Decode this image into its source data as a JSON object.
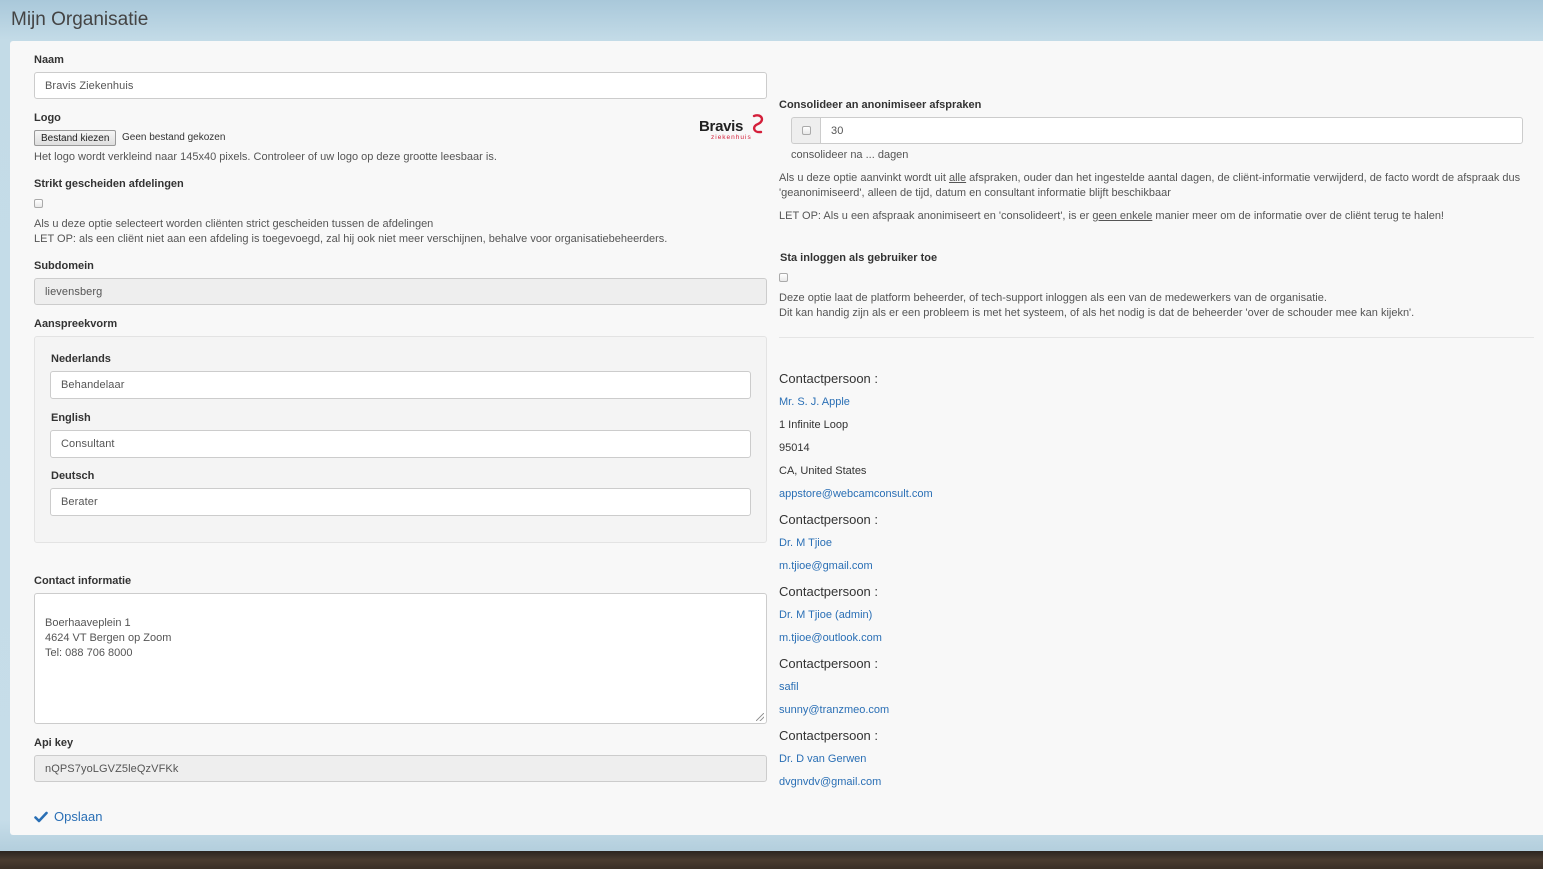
{
  "page": {
    "title": "Mijn Organisatie"
  },
  "left": {
    "naam": {
      "label": "Naam",
      "value": "Bravis Ziekenhuis"
    },
    "logo": {
      "label": "Logo",
      "file_button": "Bestand kiezen",
      "file_status": "Geen bestand gekozen",
      "help": "Het logo wordt verkleind naar 145x40 pixels. Controleer of uw logo op deze grootte leesbaar is.",
      "logo_text": "Bravis",
      "logo_subtext": "ziekenhuis",
      "logo_color": "#d41f3a"
    },
    "strikt": {
      "label": "Strikt gescheiden afdelingen",
      "help1": "Als u deze optie selecteert worden cliënten strict gescheiden tussen de afdelingen",
      "help2": "LET OP: als een cliënt niet aan een afdeling is toegevoegd, zal hij ook niet meer verschijnen, behalve voor organisatiebeheerders."
    },
    "subdomein": {
      "label": "Subdomein",
      "value": "lievensberg"
    },
    "aanspreekvorm": {
      "label": "Aanspreekvorm",
      "nederlands": {
        "label": "Nederlands",
        "value": "Behandelaar"
      },
      "english": {
        "label": "English",
        "value": "Consultant"
      },
      "deutsch": {
        "label": "Deutsch",
        "value": "Berater"
      }
    },
    "contact": {
      "label": "Contact informatie",
      "value": "Boerhaaveplein 1\n4624 VT Bergen op Zoom\nTel: 088 706 8000"
    },
    "apikey": {
      "label": "Api key",
      "value": "nQPS7yoLGVZ5leQzVFKk"
    },
    "save_label": "Opslaan"
  },
  "right": {
    "consolideer": {
      "label": "Consolideer an anonimiseer afspraken",
      "days_value": "30",
      "days_help": "consolideer na ... dagen",
      "help1_a": "Als u deze optie aanvinkt wordt uit ",
      "help1_u": "alle",
      "help1_b": " afspraken, ouder dan het ingestelde aantal dagen, de cliënt-informatie verwijderd, de facto wordt de afspraak dus",
      "help1_c": "'geanonimiseerd', alleen de tijd, datum en consultant informatie blijft beschikbaar",
      "help2_a": "LET OP: Als u een afspraak anonimiseert en 'consolideert', is er ",
      "help2_u": "geen enkele",
      "help2_b": " manier meer om de informatie over de cliënt terug te halen!"
    },
    "inloggen": {
      "label": "Sta inloggen als gebruiker toe",
      "help1": "Deze optie laat de platform beheerder, of tech-support inloggen als een van de medewerkers van de organisatie.",
      "help2": "Dit kan handig zijn als er een probleem is met het systeem, of als het nodig is dat de beheerder 'over de schouder mee kan kijekn'."
    },
    "contacts": [
      {
        "title": "Contactpersoon :",
        "name": "Mr. S. J. Apple",
        "address": "1 Infinite Loop",
        "zip": "95014",
        "region": "CA, United States",
        "email": "appstore@webcamconsult.com"
      },
      {
        "title": "Contactpersoon :",
        "name": "Dr. M Tjioe",
        "email": "m.tjioe@gmail.com"
      },
      {
        "title": "Contactpersoon :",
        "name": "Dr. M Tjioe (admin)",
        "email": "m.tjioe@outlook.com"
      },
      {
        "title": "Contactpersoon :",
        "name": "safil",
        "email": "sunny@tranzmeo.com"
      },
      {
        "title": "Contactpersoon :",
        "name": "Dr. D van Gerwen",
        "email": "dvgnvdv@gmail.com"
      }
    ]
  }
}
